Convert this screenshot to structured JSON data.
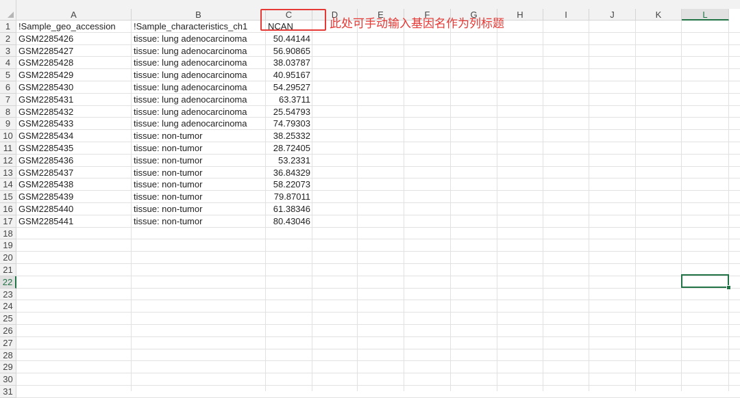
{
  "columns": [
    "A",
    "B",
    "C",
    "D",
    "E",
    "F",
    "G",
    "H",
    "I",
    "J",
    "K",
    "L"
  ],
  "rows": [
    "1",
    "2",
    "3",
    "4",
    "5",
    "6",
    "7",
    "8",
    "9",
    "10",
    "11",
    "12",
    "13",
    "14",
    "15",
    "16",
    "17",
    "18",
    "19",
    "20",
    "21",
    "22",
    "23",
    "24",
    "25",
    "26",
    "27",
    "28",
    "29",
    "30",
    "31"
  ],
  "header_row": {
    "A": "!Sample_geo_accession",
    "B": "!Sample_characteristics_ch1",
    "C": "NCAN"
  },
  "data_rows": [
    [
      "GSM2285426",
      "tissue: lung adenocarcinoma",
      "50.44144"
    ],
    [
      "GSM2285427",
      "tissue: lung adenocarcinoma",
      "56.90865"
    ],
    [
      "GSM2285428",
      "tissue: lung adenocarcinoma",
      "38.03787"
    ],
    [
      "GSM2285429",
      "tissue: lung adenocarcinoma",
      "40.95167"
    ],
    [
      "GSM2285430",
      "tissue: lung adenocarcinoma",
      "54.29527"
    ],
    [
      "GSM2285431",
      "tissue: lung adenocarcinoma",
      "63.3711"
    ],
    [
      "GSM2285432",
      "tissue: lung adenocarcinoma",
      "25.54793"
    ],
    [
      "GSM2285433",
      "tissue: lung adenocarcinoma",
      "74.79303"
    ],
    [
      "GSM2285434",
      "tissue: non-tumor",
      "38.25332"
    ],
    [
      "GSM2285435",
      "tissue: non-tumor",
      "28.72405"
    ],
    [
      "GSM2285436",
      "tissue: non-tumor",
      "53.2331"
    ],
    [
      "GSM2285437",
      "tissue: non-tumor",
      "36.84329"
    ],
    [
      "GSM2285438",
      "tissue: non-tumor",
      "58.22073"
    ],
    [
      "GSM2285439",
      "tissue: non-tumor",
      "79.87011"
    ],
    [
      "GSM2285440",
      "tissue: non-tumor",
      "61.38346"
    ],
    [
      "GSM2285441",
      "tissue: non-tumor",
      "80.43046"
    ]
  ],
  "annotation": "此处可手动输入基因名作为列标题",
  "selected": {
    "column": "L",
    "row": "22"
  },
  "colors": {
    "accent": "#217346",
    "annotation": "#e53935",
    "grid": "#e1e1e1",
    "header_bg": "#f2f2f2"
  }
}
